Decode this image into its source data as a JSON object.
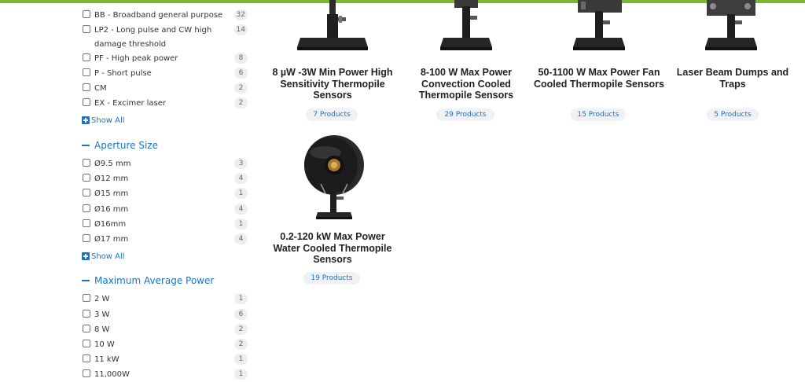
{
  "colors": {
    "accent": "#1a74c9",
    "topbar": "#7ab733",
    "badge_bg": "#eceef1",
    "pill_bg": "#eef1f5"
  },
  "sidebar": {
    "laser_types": [
      {
        "label": "BB - Broadband general purpose",
        "count": "32"
      },
      {
        "label": "LP2 - Long pulse and CW high damage threshold",
        "count": "14"
      },
      {
        "label": "PF - High peak power",
        "count": "8"
      },
      {
        "label": "P - Short pulse",
        "count": "6"
      },
      {
        "label": "CM",
        "count": "2"
      },
      {
        "label": "EX - Excimer laser",
        "count": "2"
      }
    ],
    "show_all_1": "Show All",
    "aperture": {
      "title": "Aperture Size",
      "items": [
        {
          "label": "Ø9.5 mm",
          "count": "3"
        },
        {
          "label": "Ø12 mm",
          "count": "4"
        },
        {
          "label": "Ø15 mm",
          "count": "1"
        },
        {
          "label": "Ø16 mm",
          "count": "4"
        },
        {
          "label": "Ø16mm",
          "count": "1"
        },
        {
          "label": "Ø17 mm",
          "count": "4"
        }
      ],
      "show_all": "Show All"
    },
    "max_power": {
      "title": "Maximum Average Power",
      "items": [
        {
          "label": "2 W",
          "count": "1"
        },
        {
          "label": "3 W",
          "count": "6"
        },
        {
          "label": "8 W",
          "count": "2"
        },
        {
          "label": "10 W",
          "count": "2"
        },
        {
          "label": "11 kW",
          "count": "1"
        },
        {
          "label": "11,000W",
          "count": "1"
        }
      ]
    }
  },
  "products": [
    {
      "title": "8 µW -3W Min Power High Sensitivity Thermopile Sensors",
      "count": "7 Products"
    },
    {
      "title": "8-100 W Max Power Convection Cooled Thermopile Sensors",
      "count": "29 Products"
    },
    {
      "title": "50-1100 W Max Power Fan Cooled Thermopile Sensors",
      "count": "15 Products"
    },
    {
      "title": "Laser Beam Dumps and Traps",
      "count": "5 Products"
    },
    {
      "title": "0.2-120 kW Max Power Water Cooled Thermopile Sensors",
      "count": "19 Products"
    }
  ]
}
